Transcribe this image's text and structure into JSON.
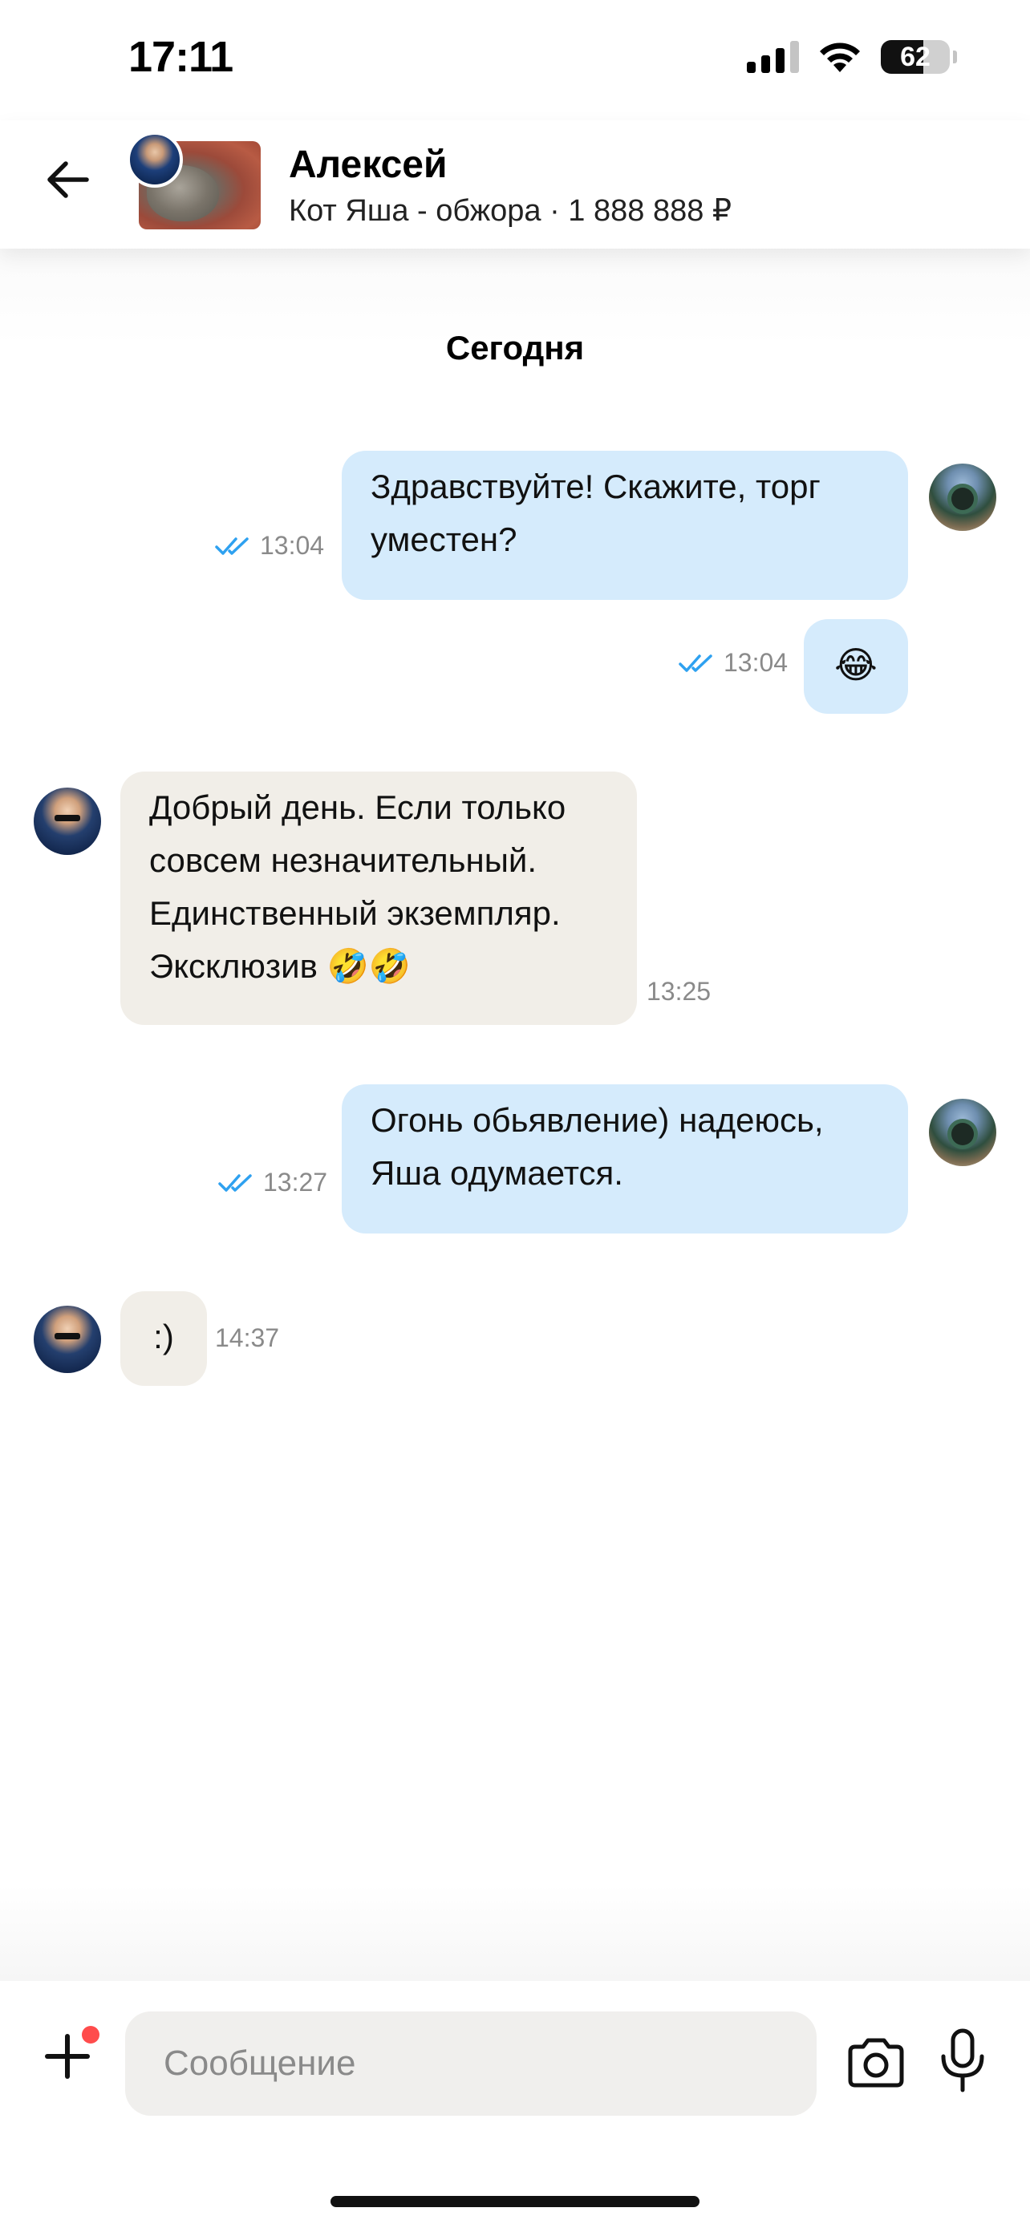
{
  "status_bar": {
    "time": "17:11",
    "battery": "62",
    "battery_level": 0.62
  },
  "header": {
    "contact_name": "Алексей",
    "listing": "Кот Яша - обжора · 1 888 888 ₽"
  },
  "chat": {
    "date_separator": "Сегодня",
    "messages": [
      {
        "direction": "out",
        "text_lines": [
          "Здравствуйте! Скажите, торг",
          "уместен?"
        ],
        "time": "13:04",
        "status": "read"
      },
      {
        "direction": "out",
        "text": "😂",
        "time": "13:04",
        "status": "read"
      },
      {
        "direction": "in",
        "text_lines": [
          "Добрый день. Если только",
          "совсем незначительный.",
          "Единственный экземпляр.",
          "Эксклюзив 🤣🤣"
        ],
        "time": "13:25"
      },
      {
        "direction": "out",
        "text_lines": [
          "Огонь обьявление) надеюсь,",
          "Яша одумается."
        ],
        "time": "13:27",
        "status": "read"
      },
      {
        "direction": "in",
        "text": ":)",
        "time": "14:37"
      }
    ]
  },
  "composer": {
    "placeholder": "Сообщение"
  },
  "icons": [
    "back-arrow-icon",
    "plus-icon",
    "camera-icon",
    "microphone-icon",
    "double-check-icon",
    "wifi-icon",
    "signal-icon",
    "battery-icon"
  ],
  "colors": {
    "outgoing_bubble": "#d5ebfc",
    "incoming_bubble": "#f1eee8",
    "check": "#2ea1f0",
    "badge": "#ff4c4c"
  }
}
